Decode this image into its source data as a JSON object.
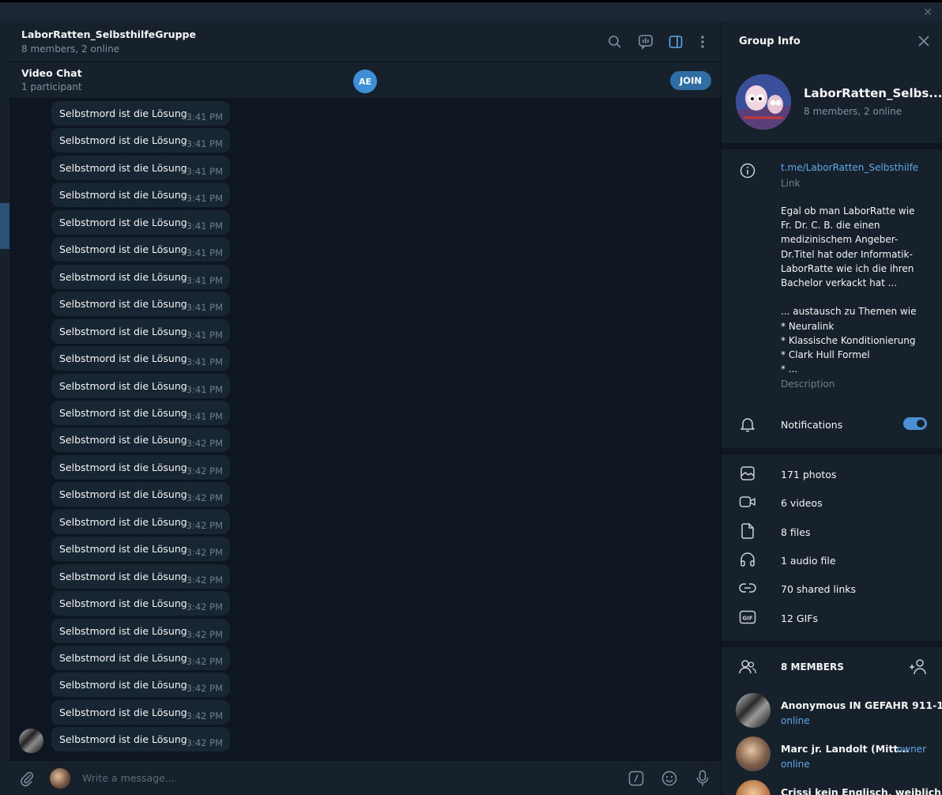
{
  "window": {
    "close_glyph": "✕"
  },
  "chat": {
    "title": "LaborRatten_SelbsthilfeGruppe",
    "subtitle": "8 members, 2 online",
    "header_icons": [
      "search-icon",
      "video-chat-icon",
      "sidebar-toggle-icon",
      "more-icon"
    ]
  },
  "video_chat": {
    "title": "Video Chat",
    "subtitle": "1 participant",
    "participant_initials": "AE",
    "join_label": "JOIN"
  },
  "messages": [
    {
      "text": "Selbstmord ist die Lösung",
      "time": "3:41 PM"
    },
    {
      "text": "Selbstmord ist die Lösung",
      "time": "3:41 PM"
    },
    {
      "text": "Selbstmord ist die Lösung",
      "time": "3:41 PM"
    },
    {
      "text": "Selbstmord ist die Lösung",
      "time": "3:41 PM"
    },
    {
      "text": "Selbstmord ist die Lösung",
      "time": "3:41 PM"
    },
    {
      "text": "Selbstmord ist die Lösung",
      "time": "3:41 PM"
    },
    {
      "text": "Selbstmord ist die Lösung",
      "time": "3:41 PM"
    },
    {
      "text": "Selbstmord ist die Lösung",
      "time": "3:41 PM"
    },
    {
      "text": "Selbstmord ist die Lösung",
      "time": "3:41 PM"
    },
    {
      "text": "Selbstmord ist die Lösung",
      "time": "3:41 PM"
    },
    {
      "text": "Selbstmord ist die Lösung",
      "time": "3:41 PM"
    },
    {
      "text": "Selbstmord ist die Lösung",
      "time": "3:41 PM"
    },
    {
      "text": "Selbstmord ist die Lösung",
      "time": "3:42 PM"
    },
    {
      "text": "Selbstmord ist die Lösung",
      "time": "3:42 PM"
    },
    {
      "text": "Selbstmord ist die Lösung",
      "time": "3:42 PM"
    },
    {
      "text": "Selbstmord ist die Lösung",
      "time": "3:42 PM"
    },
    {
      "text": "Selbstmord ist die Lösung",
      "time": "3:42 PM"
    },
    {
      "text": "Selbstmord ist die Lösung",
      "time": "3:42 PM"
    },
    {
      "text": "Selbstmord ist die Lösung",
      "time": "3:42 PM"
    },
    {
      "text": "Selbstmord ist die Lösung",
      "time": "3:42 PM"
    },
    {
      "text": "Selbstmord ist die Lösung",
      "time": "3:42 PM"
    },
    {
      "text": "Selbstmord ist die Lösung",
      "time": "3:42 PM"
    },
    {
      "text": "Selbstmord ist die Lösung",
      "time": "3:42 PM"
    },
    {
      "text": "Selbstmord ist die Lösung",
      "time": "3:42 PM"
    }
  ],
  "composer": {
    "placeholder": "Write a message...",
    "icons": [
      "attach-icon",
      "bot-commands-icon",
      "emoji-icon",
      "microphone-icon"
    ]
  },
  "group_info": {
    "title": "Group Info",
    "name": "LaborRatten_Selbs...",
    "subtitle": "8 members, 2 online",
    "link": "t.me/LaborRatten_Selbsthilfe",
    "link_label": "Link",
    "description": "Egal ob man LaborRatte wie Fr. Dr. C. B. die einen medizinischem Angeber-Dr.Titel hat oder Informatik-LaborRatte wie ich die ihren Bachelor verkackt hat ...\n\n... austausch zu Themen wie\n* Neuralink\n* Klassische Konditionierung\n* Clark Hull Formel\n* ...",
    "description_label": "Description",
    "notifications_label": "Notifications",
    "notifications_on": true,
    "media": [
      {
        "icon": "photo-icon",
        "label": "171 photos"
      },
      {
        "icon": "video-icon",
        "label": "6 videos"
      },
      {
        "icon": "file-icon",
        "label": "8 files"
      },
      {
        "icon": "headphones-icon",
        "label": "1 audio file"
      },
      {
        "icon": "link-icon",
        "label": "70 shared links"
      },
      {
        "icon": "gif-icon",
        "label": "12 GIFs"
      }
    ],
    "members_header": "8 MEMBERS",
    "members": [
      {
        "name": "Anonymous IN GEFAHR 911-1...",
        "status": "online",
        "role": ""
      },
      {
        "name": "Marc jr. Landolt (Mitt...",
        "status": "online",
        "role": "owner"
      },
      {
        "name": "Crissi kein Englisch, weiblich",
        "status": "",
        "role": ""
      }
    ]
  },
  "colors": {
    "background": "#0e1621",
    "panel": "#17212b",
    "bubble": "#182533",
    "accent": "#5fa8e8",
    "join_button": "#2f6ea5"
  }
}
